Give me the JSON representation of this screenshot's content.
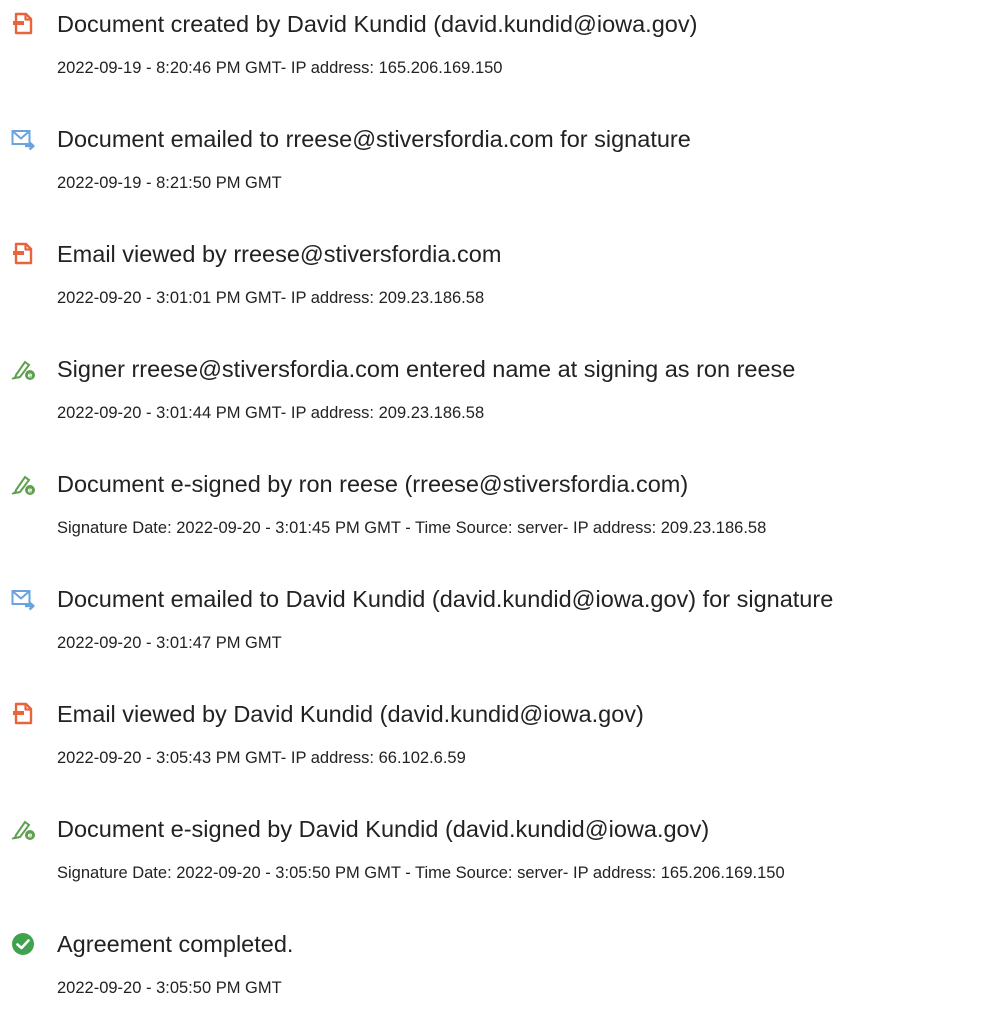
{
  "colors": {
    "document_icon": "#e9643a",
    "email_icon": "#6aa3de",
    "esign_icon": "#5fa04e",
    "completed_icon": "#3fa34d",
    "text": "#222222"
  },
  "events": [
    {
      "icon": "document-icon",
      "title": "Document created by David Kundid (david.kundid@iowa.gov)",
      "detail": "2022-09-19 - 8:20:46 PM GMT- IP address: 165.206.169.150"
    },
    {
      "icon": "email-send-icon",
      "title": "Document emailed to rreese@stiversfordia.com for signature",
      "detail": "2022-09-19 - 8:21:50 PM GMT"
    },
    {
      "icon": "document-icon",
      "title": "Email viewed by rreese@stiversfordia.com",
      "detail": "2022-09-20 - 3:01:01 PM GMT- IP address: 209.23.186.58"
    },
    {
      "icon": "esign-pen-icon",
      "title": "Signer rreese@stiversfordia.com entered name at signing as ron reese",
      "detail": "2022-09-20 - 3:01:44 PM GMT- IP address: 209.23.186.58"
    },
    {
      "icon": "esign-pen-icon",
      "title": "Document e-signed by ron reese (rreese@stiversfordia.com)",
      "detail": "Signature Date: 2022-09-20 - 3:01:45 PM GMT - Time Source: server- IP address: 209.23.186.58"
    },
    {
      "icon": "email-send-icon",
      "title": "Document emailed to David Kundid (david.kundid@iowa.gov) for signature",
      "detail": "2022-09-20 - 3:01:47 PM GMT"
    },
    {
      "icon": "document-icon",
      "title": "Email viewed by David Kundid (david.kundid@iowa.gov)",
      "detail": "2022-09-20 - 3:05:43 PM GMT- IP address: 66.102.6.59"
    },
    {
      "icon": "esign-pen-icon",
      "title": "Document e-signed by David Kundid (david.kundid@iowa.gov)",
      "detail": "Signature Date: 2022-09-20 - 3:05:50 PM GMT - Time Source: server- IP address: 165.206.169.150"
    },
    {
      "icon": "check-circle-icon",
      "title": "Agreement completed.",
      "detail": "2022-09-20 - 3:05:50 PM GMT"
    }
  ]
}
